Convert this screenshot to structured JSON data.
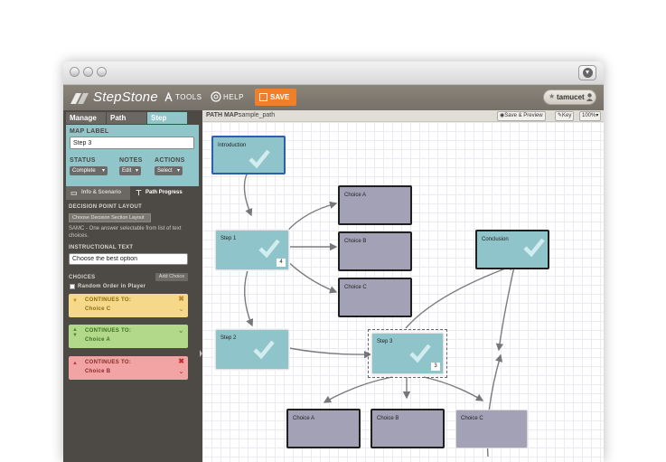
{
  "app": {
    "name": "StepStone"
  },
  "nav": {
    "tools": "TOOLS",
    "help": "HELP",
    "save": "SAVE",
    "user": "tamucet"
  },
  "tabs": [
    {
      "label": "Manage"
    },
    {
      "label": "Path"
    },
    {
      "label": "Step"
    }
  ],
  "step_panel": {
    "map_label_heading": "MAP LABEL",
    "map_label_value": "Step 3",
    "status_heading": "STATUS",
    "notes_heading": "NOTES",
    "actions_heading": "ACTIONS",
    "status_value": "Complete",
    "notes_value": "Edit",
    "actions_value": "Select"
  },
  "subtabs": {
    "info": "Info & Scenario",
    "progress": "Path Progress"
  },
  "progress_panel": {
    "layout_heading": "DECISION POINT LAYOUT",
    "layout_button": "Choose Decision Section Layout",
    "layout_desc": "SAMC - One answer selectable from list of text choices.",
    "instr_heading": "INSTRUCTIONAL TEXT",
    "instr_value": "Choose the best option",
    "choices_heading": "CHOICES",
    "add_choice": "Add Choice",
    "random_order": "Random Order in Player",
    "choices": [
      {
        "continues": "CONTINUES TO:",
        "target": "Choice C",
        "color": "#f5d88a"
      },
      {
        "continues": "CONTINUES TO:",
        "target": "Choice A",
        "color": "#b2d88a"
      },
      {
        "continues": "CONTINUES TO:",
        "target": "Choice B",
        "color": "#f2a3a3"
      }
    ]
  },
  "pathmap": {
    "label": "PATH MAP:",
    "name": "sample_path",
    "save_preview": "Save & Preview",
    "key": "Key",
    "zoom": "100%"
  },
  "nodes": {
    "introduction": "Introduction",
    "step1": "Step 1",
    "step1_badge": "4",
    "step2": "Step 2",
    "step3": "Step 3",
    "step3_badge": "3",
    "choice_a_top": "Choice A",
    "choice_b_top": "Choice B",
    "choice_c_top": "Choice C",
    "conclusion": "Conclusion",
    "choice_a_bottom": "Choice A",
    "choice_b_bottom": "Choice B",
    "choice_c_bottom": "Choice C"
  },
  "colors": {
    "accent": "#f07f2c",
    "step_teal": "#8fc4ca",
    "choice_purple": "#a3a1b6",
    "sidebar": "#4d4a46",
    "selected_tab": "#90c5ca"
  }
}
